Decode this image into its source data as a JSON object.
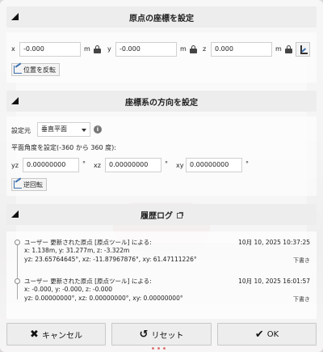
{
  "origin": {
    "title": "原点の座標を設定",
    "x_label": "x",
    "x_value": "-0.000",
    "x_unit": "m",
    "y_label": "y",
    "y_value": "-0.000",
    "y_unit": "m",
    "z_label": "z",
    "z_value": "0.000",
    "z_unit": "m",
    "apply_button": "位置を反転"
  },
  "orientation": {
    "title": "座標系の方向を設定",
    "source_label": "設定元",
    "source_value": "垂直平面",
    "angle_label": "平面角度を設定(-360 から 360 度):",
    "yz_label": "yz",
    "yz_value": "0.00000000",
    "yz_unit": "°",
    "xz_label": "xz",
    "xz_value": "0.00000000",
    "xz_unit": "°",
    "xy_label": "xy",
    "xy_value": "0.00000000",
    "xy_unit": "°",
    "reverse_button": "逆回転"
  },
  "history": {
    "title": "履歴ログ",
    "entries": [
      {
        "line1": "ユーザー 更新された原点 [原点ツール] による:",
        "line2": "x: 1.138m, y: 31.277m, z: -3.322m",
        "line3": "yz: 23.65764645°, xz: -11.87967876°, xy: 61.47111226°",
        "date": "10月 10, 2025 10:37:25",
        "status": "下書き"
      },
      {
        "line1": "ユーザー 更新された原点 [原点ツール] による:",
        "line2": "x: -0.000, y: -0.000, z: -0.000",
        "line3": "yz: 0.00000000°, xz: 0.00000000°, xy: 0.00000000°",
        "date": "10月 10, 2025 16:01:57",
        "status": "下書き"
      }
    ]
  },
  "footer": {
    "cancel": "キャンセル",
    "reset": "リセット",
    "ok": "OK"
  },
  "icons": {
    "cancel": "x-icon",
    "reset": "rotate-ccw-icon",
    "ok": "check-icon"
  }
}
